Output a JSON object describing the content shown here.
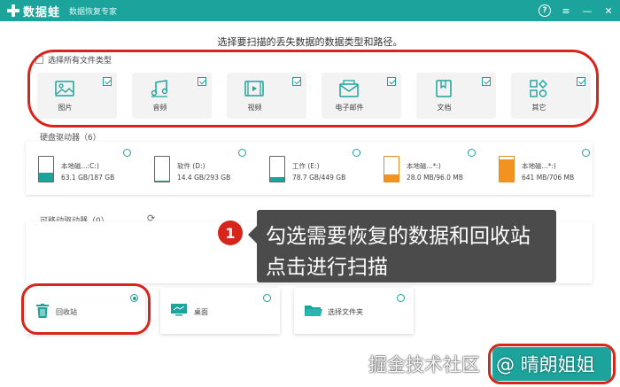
{
  "app": {
    "name": "数据蛙",
    "subtitle": "数据恢复专家",
    "brand_color": "#1ba39c",
    "controls": {
      "help": "?",
      "menu": "≡",
      "minimize": "—",
      "close": "✕"
    }
  },
  "instruction": "选择要扫描的丢失数据的数据类型和路径。",
  "file_types": {
    "select_all_label": "选择所有文件类型",
    "select_all_checked": false,
    "items": [
      {
        "label": "图片",
        "icon": "image-icon",
        "checked": true
      },
      {
        "label": "音频",
        "icon": "music-icon",
        "checked": true
      },
      {
        "label": "视频",
        "icon": "video-icon",
        "checked": true
      },
      {
        "label": "电子邮件",
        "icon": "email-icon",
        "checked": true
      },
      {
        "label": "文档",
        "icon": "document-icon",
        "checked": true
      },
      {
        "label": "其它",
        "icon": "other-icon",
        "checked": true
      }
    ]
  },
  "hard_drives": {
    "title": "硬盘驱动器（6）",
    "items": [
      {
        "name": "本地磁...:C:)",
        "size": "63.1 GB/187 GB",
        "used_fraction": 0.34,
        "color": "teal"
      },
      {
        "name": "软件 (D:)",
        "size": "14.4 GB/293 GB",
        "used_fraction": 0.05,
        "color": "teal"
      },
      {
        "name": "工作 (E:)",
        "size": "78.7 GB/449 GB",
        "used_fraction": 0.18,
        "color": "teal"
      },
      {
        "name": "本地磁...*:)",
        "size": "28.0 MB/96.0 MB",
        "used_fraction": 0.29,
        "color": "orange"
      },
      {
        "name": "本地磁...*:)",
        "size": "641 MB/706 MB",
        "used_fraction": 0.91,
        "color": "orange"
      }
    ]
  },
  "removable": {
    "title": "可移动驱动器（0）",
    "refresh_icon": "refresh-icon"
  },
  "locations": {
    "items": [
      {
        "label": "回收站",
        "icon": "trash-icon",
        "selected": true
      },
      {
        "label": "桌面",
        "icon": "desktop-icon",
        "selected": false
      },
      {
        "label": "选择文件夹",
        "icon": "folder-icon",
        "selected": false
      }
    ]
  },
  "tooltip": {
    "step": "1",
    "line1": "勾选需要恢复的数据和回收站",
    "line2": "点击进行扫描"
  },
  "watermark": {
    "text": "掘金技术社区",
    "author": "@ 晴朗姐姐"
  }
}
